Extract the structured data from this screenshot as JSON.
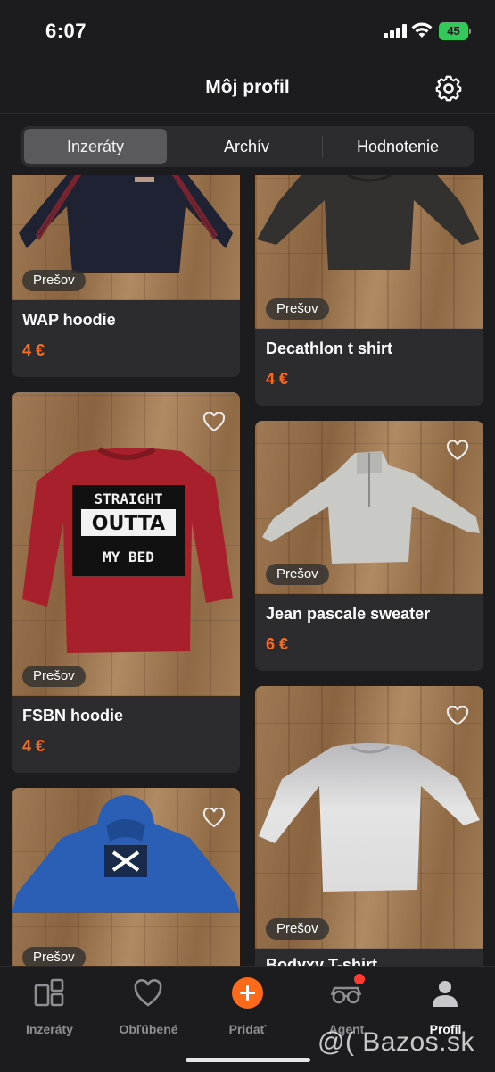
{
  "status_bar": {
    "time": "6:07",
    "battery": "45"
  },
  "header": {
    "title": "Môj profil",
    "settings_icon": "gear-icon"
  },
  "tabs": [
    "Inzeráty",
    "Archív",
    "Hodnotenie"
  ],
  "listings": {
    "left": [
      {
        "title": "WAP hoodie",
        "price": "4 €",
        "location": "Prešov",
        "color": "#1e2233"
      },
      {
        "title": "FSBN hoodie",
        "price": "4 €",
        "location": "Prešov",
        "color": "#a8202c",
        "print": [
          "STRAIGHT",
          "OUTTA",
          "MY BED"
        ]
      },
      {
        "title": "",
        "price": "",
        "location": "Prešov",
        "color": "#2b5fb5"
      }
    ],
    "right": [
      {
        "title": "Decathlon t shirt",
        "price": "4 €",
        "location": "Prešov",
        "color": "#33312f"
      },
      {
        "title": "Jean pascale sweater",
        "price": "6 €",
        "location": "Prešov",
        "color": "#c9c9c5"
      },
      {
        "title": "Bodyxy T-shirt",
        "price": "",
        "location": "Prešov",
        "color": "#d8d8d8"
      }
    ]
  },
  "bottom_nav": [
    {
      "label": "Inzeráty",
      "icon": "listings-icon"
    },
    {
      "label": "Obľúbené",
      "icon": "heart-icon"
    },
    {
      "label": "Pridať",
      "icon": "plus-icon"
    },
    {
      "label": "Agent",
      "icon": "agent-icon"
    },
    {
      "label": "Profil",
      "icon": "profile-icon"
    }
  ],
  "watermark": "@( Bazos.sk",
  "colors": {
    "accent": "#ff6a1a",
    "background": "#1c1c1e",
    "card": "#2c2c2e",
    "notification": "#ff3b30"
  }
}
